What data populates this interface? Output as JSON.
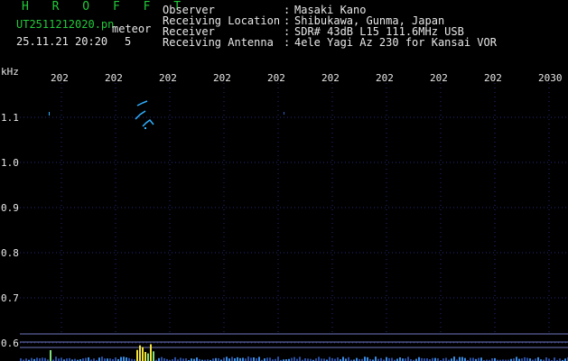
{
  "header": {
    "title": "H R O F F T",
    "file_name": "UT2511212020.pn",
    "tag": "meteor",
    "date_time": "25.11.21 20:20",
    "count": "5",
    "fields": [
      {
        "label": "Observer",
        "value": "Masaki Kano"
      },
      {
        "label": "Receiving Location",
        "value": "Shibukawa, Gunma, Japan"
      },
      {
        "label": "Receiver",
        "value": "SDR# 43dB L15 111.6MHz USB"
      },
      {
        "label": "Receiving Antenna",
        "value": "4ele Yagi Az 230 for Kansai VOR"
      }
    ],
    "colon": ":"
  },
  "axis": {
    "unit": "kHz",
    "x_ticks": [
      "202",
      "202",
      "202",
      "202",
      "202",
      "202",
      "202",
      "202",
      "202",
      "2030"
    ],
    "y_ticks": [
      "1.1",
      "1.0",
      "0.9",
      "0.8",
      "0.7",
      "0.6"
    ],
    "y_values": [
      1.1,
      1.0,
      0.9,
      0.8,
      0.7,
      0.6
    ]
  },
  "colors": {
    "header_green": "#22c93a",
    "text": "#e8e8e8",
    "grid": "#232a7a",
    "signal": "#2fb0ff",
    "spectrum_peak": "#f2e23a"
  }
}
